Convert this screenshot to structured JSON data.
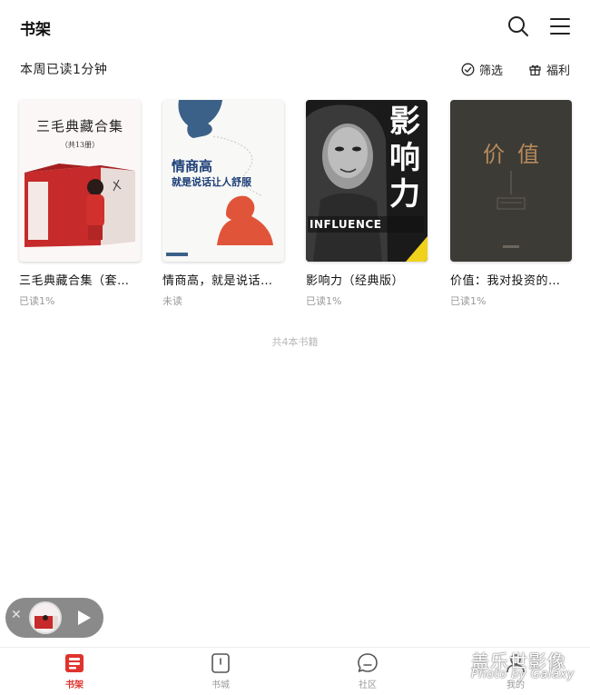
{
  "header": {
    "title": "书架",
    "search_icon": "search-icon",
    "menu_icon": "menu-icon"
  },
  "subbar": {
    "reading_time": "本周已读1分钟",
    "filter_label": "筛选",
    "welfare_label": "福利"
  },
  "books": [
    {
      "title": "三毛典藏合集（套…",
      "status": "已读1%",
      "cover_title": "三毛典藏合集",
      "cover_subtitle": "（共13册）"
    },
    {
      "title": "情商高，就是说话…",
      "status": "未读",
      "cover_title": "情商高",
      "cover_subtitle": "就是说话让人舒服"
    },
    {
      "title": "影响力（经典版）",
      "status": "已读1%",
      "cover_title": "影响力",
      "cover_english": "INFLUENCE"
    },
    {
      "title": "价值：我对投资的…",
      "status": "已读1%",
      "cover_title": "价值"
    }
  ],
  "total_label": "共4本书籍",
  "player": {
    "close_icon": "close-icon",
    "play_icon": "play-icon"
  },
  "bottom_nav": [
    {
      "label": "书架",
      "icon": "bookshelf-icon",
      "active": true
    },
    {
      "label": "书城",
      "icon": "bookstore-icon",
      "active": false
    },
    {
      "label": "社区",
      "icon": "community-icon",
      "active": false
    },
    {
      "label": "我的",
      "icon": "profile-icon",
      "active": false
    }
  ],
  "watermark": {
    "line1": "盖乐世影像",
    "line2": "Photo by Galaxy"
  },
  "colors": {
    "accent": "#e0332d",
    "text_primary": "#111111",
    "text_secondary": "#999999"
  }
}
